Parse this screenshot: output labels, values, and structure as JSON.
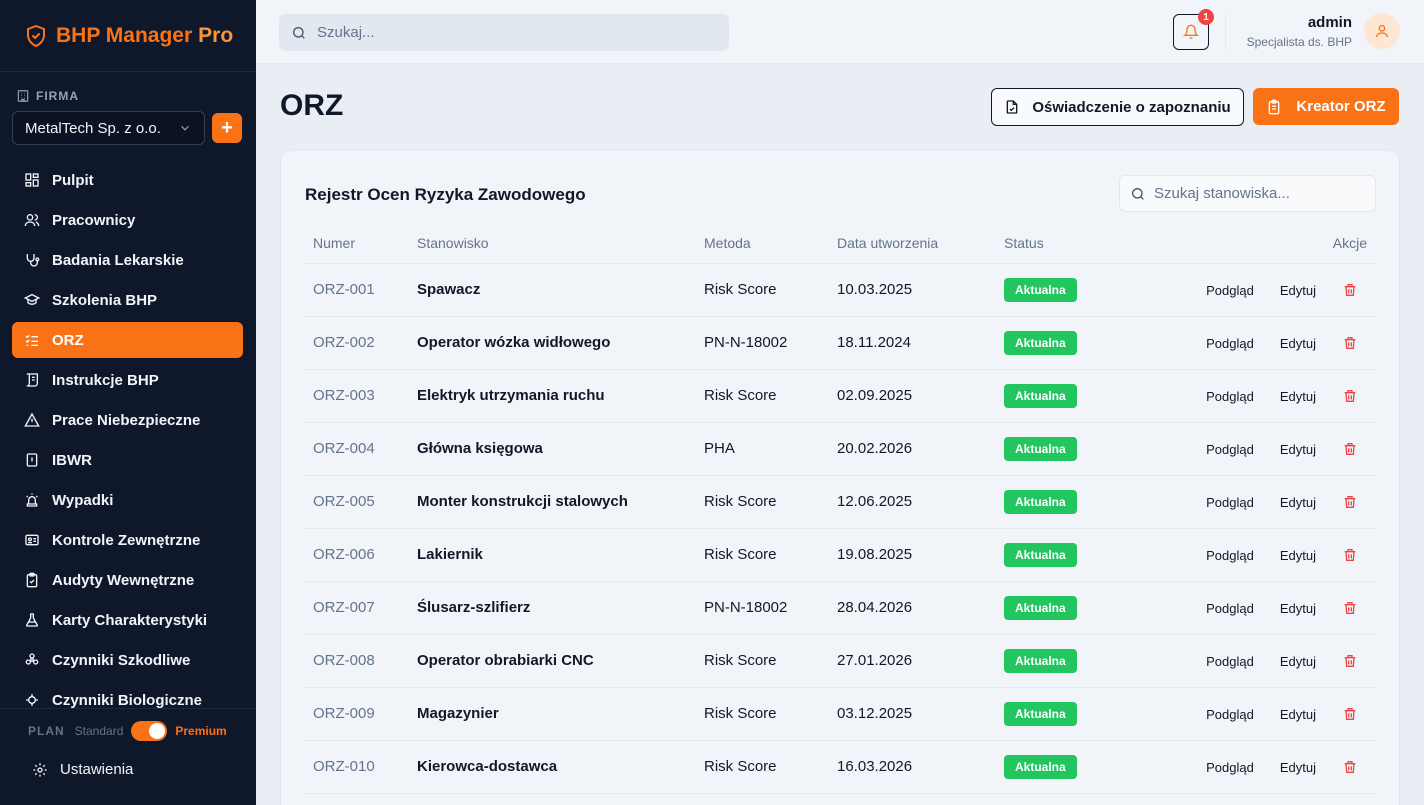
{
  "brand": {
    "name": "BHP Manager",
    "suffix": "Pro"
  },
  "company": {
    "section_label": "FIRMA",
    "selected": "MetalTech Sp. z o.o.",
    "add_label": "+"
  },
  "nav": [
    {
      "label": "Pulpit",
      "icon": "dashboard-icon"
    },
    {
      "label": "Pracownicy",
      "icon": "users-icon"
    },
    {
      "label": "Badania Lekarskie",
      "icon": "stethoscope-icon"
    },
    {
      "label": "Szkolenia BHP",
      "icon": "graduation-cap-icon"
    },
    {
      "label": "ORZ",
      "icon": "list-checks-icon",
      "active": true
    },
    {
      "label": "Instrukcje BHP",
      "icon": "scroll-icon"
    },
    {
      "label": "Prace Niebezpieczne",
      "icon": "warning-triangle-icon"
    },
    {
      "label": "IBWR",
      "icon": "file-icon"
    },
    {
      "label": "Wypadki",
      "icon": "siren-icon"
    },
    {
      "label": "Kontrole Zewnętrzne",
      "icon": "id-card-icon"
    },
    {
      "label": "Audyty Wewnętrzne",
      "icon": "clipboard-check-icon"
    },
    {
      "label": "Karty Charakterystyki",
      "icon": "flask-icon"
    },
    {
      "label": "Czynniki Szkodliwe",
      "icon": "biohazard-icon"
    },
    {
      "label": "Czynniki Biologiczne",
      "icon": "microbe-icon"
    }
  ],
  "plan": {
    "label": "PLAN",
    "standard": "Standard",
    "premium": "Premium"
  },
  "settings": {
    "label": "Ustawienia"
  },
  "topbar": {
    "search_placeholder": "Szukaj...",
    "notifications": "1",
    "user_name": "admin",
    "user_role": "Specjalista ds. BHP"
  },
  "page": {
    "title": "ORZ",
    "btn_statement": "Oświadczenie o zapoznaniu",
    "btn_creator": "Kreator ORZ"
  },
  "register": {
    "title": "Rejestr Ocen Ryzyka Zawodowego",
    "search_placeholder": "Szukaj stanowiska...",
    "columns": [
      "Numer",
      "Stanowisko",
      "Metoda",
      "Data utworzenia",
      "Status",
      "Akcje"
    ],
    "action_view": "Podgląd",
    "action_edit": "Edytuj",
    "rows": [
      {
        "num": "ORZ-001",
        "pos": "Spawacz",
        "method": "Risk Score",
        "date": "10.03.2025",
        "status": "Aktualna"
      },
      {
        "num": "ORZ-002",
        "pos": "Operator wózka widłowego",
        "method": "PN-N-18002",
        "date": "18.11.2024",
        "status": "Aktualna"
      },
      {
        "num": "ORZ-003",
        "pos": "Elektryk utrzymania ruchu",
        "method": "Risk Score",
        "date": "02.09.2025",
        "status": "Aktualna"
      },
      {
        "num": "ORZ-004",
        "pos": "Główna księgowa",
        "method": "PHA",
        "date": "20.02.2026",
        "status": "Aktualna"
      },
      {
        "num": "ORZ-005",
        "pos": "Monter konstrukcji stalowych",
        "method": "Risk Score",
        "date": "12.06.2025",
        "status": "Aktualna"
      },
      {
        "num": "ORZ-006",
        "pos": "Lakiernik",
        "method": "Risk Score",
        "date": "19.08.2025",
        "status": "Aktualna"
      },
      {
        "num": "ORZ-007",
        "pos": "Ślusarz-szlifierz",
        "method": "PN-N-18002",
        "date": "28.04.2026",
        "status": "Aktualna"
      },
      {
        "num": "ORZ-008",
        "pos": "Operator obrabiarki CNC",
        "method": "Risk Score",
        "date": "27.01.2026",
        "status": "Aktualna"
      },
      {
        "num": "ORZ-009",
        "pos": "Magazynier",
        "method": "Risk Score",
        "date": "03.12.2025",
        "status": "Aktualna"
      },
      {
        "num": "ORZ-010",
        "pos": "Kierowca-dostawca",
        "method": "Risk Score",
        "date": "16.03.2026",
        "status": "Aktualna"
      }
    ]
  },
  "colors": {
    "accent": "#f97316",
    "sidebar": "#0f172a",
    "status_ok": "#22c55e",
    "danger": "#ef4444"
  }
}
